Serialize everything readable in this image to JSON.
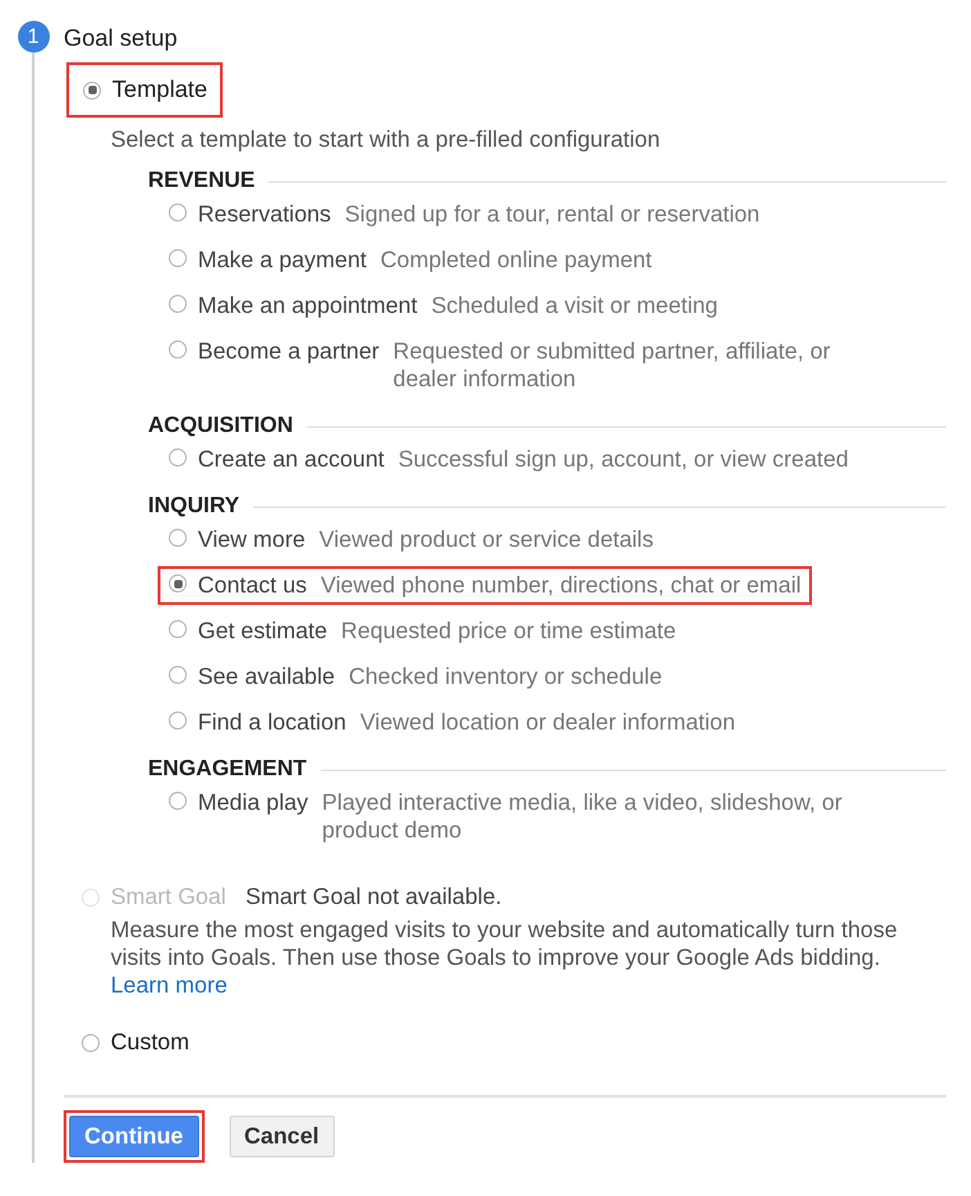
{
  "step": {
    "number": "1",
    "title": "Goal setup"
  },
  "template": {
    "label": "Template",
    "selected": true,
    "highlighted": true,
    "description": "Select a template to start with a pre-filled configuration",
    "categories": [
      {
        "name": "REVENUE",
        "items": [
          {
            "label": "Reservations",
            "description": "Signed up for a tour, rental or reservation",
            "selected": false,
            "highlighted": false
          },
          {
            "label": "Make a payment",
            "description": "Completed online payment",
            "selected": false,
            "highlighted": false
          },
          {
            "label": "Make an appointment",
            "description": "Scheduled a visit or meeting",
            "selected": false,
            "highlighted": false
          },
          {
            "label": "Become a partner",
            "description": "Requested or submitted partner, affiliate, or dealer information",
            "selected": false,
            "highlighted": false
          }
        ]
      },
      {
        "name": "ACQUISITION",
        "items": [
          {
            "label": "Create an account",
            "description": "Successful sign up, account, or view created",
            "selected": false,
            "highlighted": false
          }
        ]
      },
      {
        "name": "INQUIRY",
        "items": [
          {
            "label": "View more",
            "description": "Viewed product or service details",
            "selected": false,
            "highlighted": false
          },
          {
            "label": "Contact us",
            "description": "Viewed phone number, directions, chat or email",
            "selected": true,
            "highlighted": true
          },
          {
            "label": "Get estimate",
            "description": "Requested price or time estimate",
            "selected": false,
            "highlighted": false
          },
          {
            "label": "See available",
            "description": "Checked inventory or schedule",
            "selected": false,
            "highlighted": false
          },
          {
            "label": "Find a location",
            "description": "Viewed location or dealer information",
            "selected": false,
            "highlighted": false
          }
        ]
      },
      {
        "name": "ENGAGEMENT",
        "items": [
          {
            "label": "Media play",
            "description": "Played interactive media, like a video, slideshow, or product demo",
            "selected": false,
            "highlighted": false
          }
        ]
      }
    ]
  },
  "smart_goal": {
    "label": "Smart Goal",
    "disabled": true,
    "selected": false,
    "status": "Smart Goal not available.",
    "description": "Measure the most engaged visits to your website and automatically turn those visits into Goals. Then use those Goals to improve your Google Ads bidding.",
    "link": "Learn more"
  },
  "custom": {
    "label": "Custom",
    "selected": false
  },
  "buttons": [
    {
      "label": "Continue",
      "kind": "primary",
      "highlighted": true
    },
    {
      "label": "Cancel",
      "kind": "secondary",
      "highlighted": false
    }
  ]
}
